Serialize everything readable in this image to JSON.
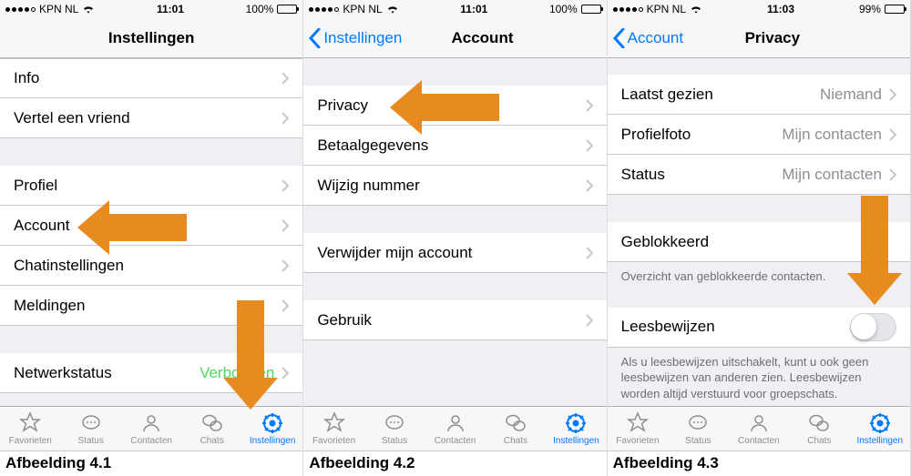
{
  "screens": [
    {
      "status": {
        "carrier": "KPN NL",
        "time": "11:01",
        "battery_pct": "100%"
      },
      "nav": {
        "back": null,
        "title": "Instellingen"
      },
      "groups": [
        [
          {
            "label": "Info",
            "value": null,
            "chevron": true
          },
          {
            "label": "Vertel een vriend",
            "value": null,
            "chevron": true
          }
        ],
        [
          {
            "label": "Profiel",
            "value": null,
            "chevron": true
          },
          {
            "label": "Account",
            "value": null,
            "chevron": true
          },
          {
            "label": "Chatinstellingen",
            "value": null,
            "chevron": true
          },
          {
            "label": "Meldingen",
            "value": null,
            "chevron": true
          }
        ],
        [
          {
            "label": "Netwerkstatus",
            "value": "Verbonden",
            "value_color": "green",
            "chevron": true
          }
        ]
      ],
      "caption": "Afbeelding 4.1"
    },
    {
      "status": {
        "carrier": "KPN NL",
        "time": "11:01",
        "battery_pct": "100%"
      },
      "nav": {
        "back": "Instellingen",
        "title": "Account"
      },
      "groups": [
        [
          {
            "label": "Privacy",
            "value": null,
            "chevron": true
          },
          {
            "label": "Betaalgegevens",
            "value": null,
            "chevron": true
          },
          {
            "label": "Wijzig nummer",
            "value": null,
            "chevron": true
          }
        ],
        [
          {
            "label": "Verwijder mijn account",
            "value": null,
            "chevron": true
          }
        ],
        [
          {
            "label": "Gebruik",
            "value": null,
            "chevron": true
          }
        ]
      ],
      "caption": "Afbeelding 4.2"
    },
    {
      "status": {
        "carrier": "KPN NL",
        "time": "11:03",
        "battery_pct": "99%"
      },
      "nav": {
        "back": "Account",
        "title": "Privacy"
      },
      "rows": [
        {
          "label": "Laatst gezien",
          "value": "Niemand",
          "chevron": true
        },
        {
          "label": "Profielfoto",
          "value": "Mijn contacten",
          "chevron": true
        },
        {
          "label": "Status",
          "value": "Mijn contacten",
          "chevron": true
        }
      ],
      "blocked": {
        "label": "Geblokkeerd",
        "footer": "Overzicht van geblokkeerde contacten."
      },
      "readreceipts": {
        "label": "Leesbewijzen",
        "footer": "Als u leesbewijzen uitschakelt, kunt u ook geen leesbewijzen van anderen zien. Leesbewijzen worden altijd verstuurd voor groepschats."
      },
      "caption": "Afbeelding 4.3"
    }
  ],
  "tabs": [
    {
      "label": "Favorieten"
    },
    {
      "label": "Status"
    },
    {
      "label": "Contacten"
    },
    {
      "label": "Chats"
    },
    {
      "label": "Instellingen"
    }
  ]
}
